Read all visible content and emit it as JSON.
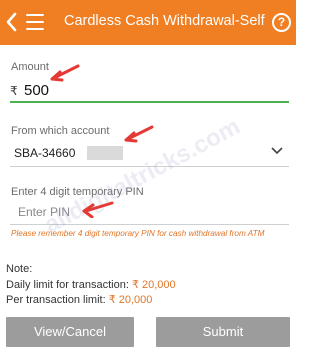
{
  "header": {
    "title": "Cardless Cash Withdrawal-Self",
    "back_icon": "chevron-left-icon",
    "menu_icon": "hamburger-menu-icon",
    "help_icon": "question-circle-icon",
    "help_glyph": "?",
    "color": "#f07e22"
  },
  "amount": {
    "label": "Amount",
    "currency_symbol": "₹",
    "value": "500"
  },
  "account": {
    "label": "From which account",
    "value": "SBA-34660"
  },
  "pin": {
    "label": "Enter 4 digit temporary PIN",
    "placeholder": "Enter PIN",
    "hint": "Please remember 4 digit temporary PIN for cash withdrawal from ATM"
  },
  "watermark": "alldigitaltricks.com",
  "notes": {
    "title": "Note:",
    "daily_label": "Daily limit for transaction: ",
    "daily_amount": "₹ 20,000",
    "per_label": "Per transaction limit: ",
    "per_amount": "₹ 20,000"
  },
  "buttons": {
    "cancel": "View/Cancel",
    "submit": "Submit"
  },
  "colors": {
    "accent": "#f07e22",
    "active_underline": "#4caf50",
    "hint": "#e0762a",
    "annotation_arrow": "#e53935",
    "button": "#9c9c9c"
  }
}
